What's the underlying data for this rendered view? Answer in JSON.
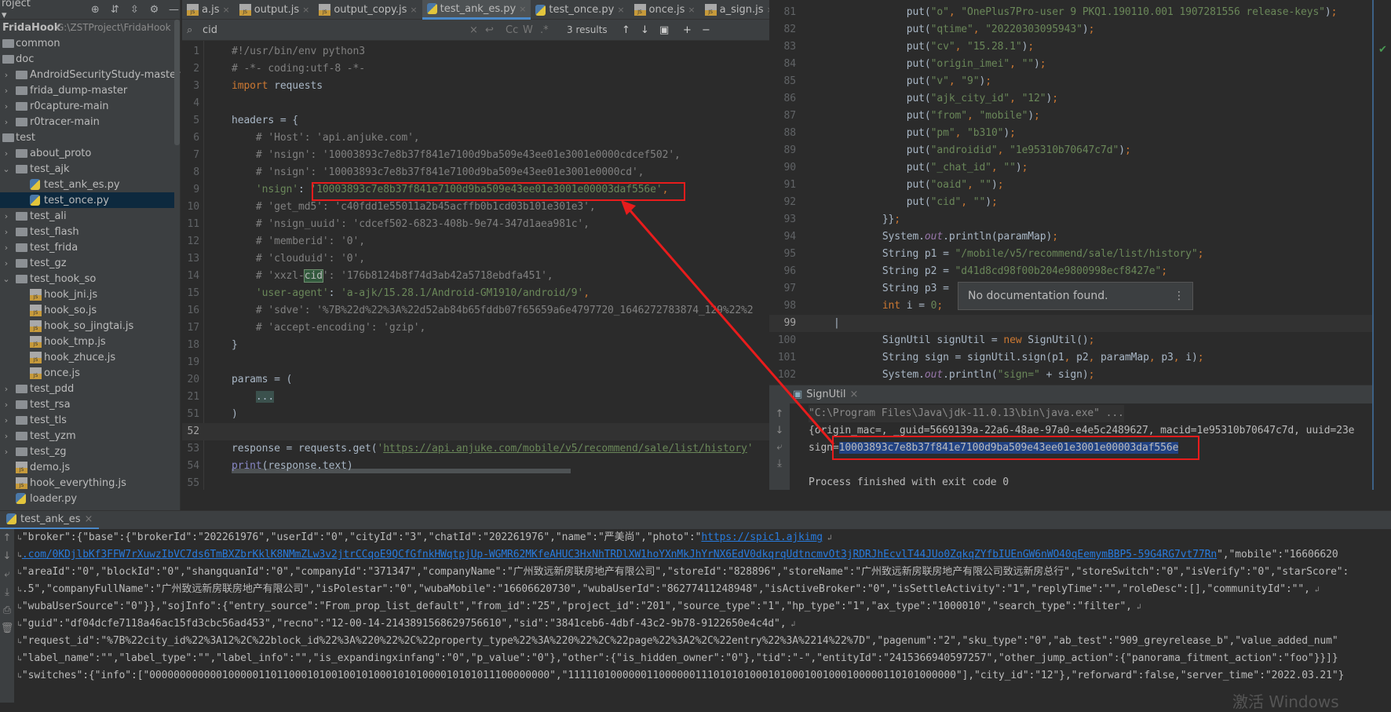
{
  "project_toolbar": {
    "title": "roject",
    "icons": [
      "target-icon",
      "expand-all-icon",
      "collapse-all-icon",
      "gear-icon",
      "minimize-icon"
    ]
  },
  "tree": [
    {
      "label": "FridaHook",
      "path": "G:\\ZSTProject\\FridaHook",
      "type": "root",
      "level": 0
    },
    {
      "label": "common",
      "type": "folder",
      "level": 0,
      "arrow": ""
    },
    {
      "label": "doc",
      "type": "folder",
      "level": 0,
      "arrow": ""
    },
    {
      "label": "AndroidSecurityStudy-master",
      "type": "folder",
      "level": 0,
      "arrow": "›"
    },
    {
      "label": "frida_dump-master",
      "type": "folder",
      "level": 0,
      "arrow": "›"
    },
    {
      "label": "r0capture-main",
      "type": "folder",
      "level": 0,
      "arrow": "›"
    },
    {
      "label": "r0tracer-main",
      "type": "folder",
      "level": 0,
      "arrow": "›"
    },
    {
      "label": "test",
      "type": "folder",
      "level": 0,
      "arrow": ""
    },
    {
      "label": "about_proto",
      "type": "folder",
      "level": 0,
      "arrow": "›"
    },
    {
      "label": "test_ajk",
      "type": "folder",
      "level": 0,
      "arrow": "⌄"
    },
    {
      "label": "test_ank_es.py",
      "type": "py",
      "level": 1
    },
    {
      "label": "test_once.py",
      "type": "py",
      "level": 1,
      "selected": true
    },
    {
      "label": "test_ali",
      "type": "folder",
      "level": 0,
      "arrow": "›"
    },
    {
      "label": "test_flash",
      "type": "folder",
      "level": 0,
      "arrow": "›"
    },
    {
      "label": "test_frida",
      "type": "folder",
      "level": 0,
      "arrow": "›"
    },
    {
      "label": "test_gz",
      "type": "folder",
      "level": 0,
      "arrow": "›"
    },
    {
      "label": "test_hook_so",
      "type": "folder",
      "level": 0,
      "arrow": "⌄"
    },
    {
      "label": "hook_jni.js",
      "type": "js",
      "level": 1
    },
    {
      "label": "hook_so.js",
      "type": "js",
      "level": 1
    },
    {
      "label": "hook_so_jingtai.js",
      "type": "js",
      "level": 1
    },
    {
      "label": "hook_tmp.js",
      "type": "js",
      "level": 1
    },
    {
      "label": "hook_zhuce.js",
      "type": "js",
      "level": 1
    },
    {
      "label": "once.js",
      "type": "js",
      "level": 1
    },
    {
      "label": "test_pdd",
      "type": "folder",
      "level": 0,
      "arrow": "›"
    },
    {
      "label": "test_rsa",
      "type": "folder",
      "level": 0,
      "arrow": "›"
    },
    {
      "label": "test_tls",
      "type": "folder",
      "level": 0,
      "arrow": "›"
    },
    {
      "label": "test_yzm",
      "type": "folder",
      "level": 0,
      "arrow": "›"
    },
    {
      "label": "test_zg",
      "type": "folder",
      "level": 0,
      "arrow": "›"
    },
    {
      "label": "demo.js",
      "type": "js",
      "level": 0
    },
    {
      "label": "hook_everything.js",
      "type": "js",
      "level": 0
    },
    {
      "label": "loader.py",
      "type": "py",
      "level": 0
    }
  ],
  "tabs": [
    {
      "label": "a.js",
      "type": "js"
    },
    {
      "label": "output.js",
      "type": "js"
    },
    {
      "label": "output_copy.js",
      "type": "js"
    },
    {
      "label": "test_ank_es.py",
      "type": "py",
      "active": true
    },
    {
      "label": "test_once.py",
      "type": "py"
    },
    {
      "label": "once.js",
      "type": "js"
    },
    {
      "label": "a_sign.js",
      "type": "js"
    }
  ],
  "search": {
    "value": "cid",
    "results": "3 results",
    "case_label": "Cc",
    "word_label": "W",
    "regex_label": ".*"
  },
  "editor_lines": [
    {
      "n": "1",
      "t": [
        [
          "c",
          "#!/usr/bin/env python3"
        ]
      ]
    },
    {
      "n": "2",
      "t": [
        [
          "c",
          "# -*- coding:utf-8 -*-"
        ]
      ]
    },
    {
      "n": "3",
      "t": [
        [
          "k",
          "import"
        ],
        [
          "p",
          " requests"
        ]
      ]
    },
    {
      "n": "4",
      "t": []
    },
    {
      "n": "5",
      "t": [
        [
          "p",
          "headers = {"
        ]
      ]
    },
    {
      "n": "6",
      "t": [
        [
          "c",
          "    # 'Host': 'api.anjuke.com',"
        ]
      ]
    },
    {
      "n": "7",
      "t": [
        [
          "c",
          "    # 'nsign': '10003893c7e8b37f841e7100d9ba509e43ee01e3001e0000cdcef502',"
        ]
      ]
    },
    {
      "n": "8",
      "t": [
        [
          "c",
          "    # 'nsign': '10003893c7e8b37f841e7100d9ba509e43ee01e3001e0000cd',"
        ]
      ]
    },
    {
      "n": "9",
      "t": [
        [
          "s",
          "    'nsign'"
        ],
        [
          "p",
          ": "
        ],
        [
          "s",
          "'10003893c7e8b37f841e7100d9ba509e43ee01e3001e00003daf556e'"
        ],
        [
          "k",
          ","
        ]
      ]
    },
    {
      "n": "10",
      "t": [
        [
          "c",
          "    # 'get_md5': 'c40fdd1e55011a2b45acffb0b1cd03b101e301e3',"
        ]
      ]
    },
    {
      "n": "11",
      "t": [
        [
          "c",
          "    # 'nsign_uuid': 'cdcef502-6823-408b-9e74-347d1aea981c',"
        ]
      ]
    },
    {
      "n": "12",
      "t": [
        [
          "c",
          "    # 'memberid': '0',"
        ]
      ]
    },
    {
      "n": "13",
      "t": [
        [
          "c",
          "    # 'clouduid': '0',"
        ]
      ]
    },
    {
      "n": "14",
      "t": [
        [
          "c",
          "    # 'xxzl-"
        ],
        [
          "h",
          "cid"
        ],
        [
          "c",
          "': '176b8124b8f74d3ab42a5718ebdfa451',"
        ]
      ]
    },
    {
      "n": "15",
      "t": [
        [
          "s",
          "    'user-agent'"
        ],
        [
          "p",
          ": "
        ],
        [
          "s",
          "'a-ajk/15.28.1/Android-GM1910/android/9'"
        ],
        [
          "k",
          ","
        ]
      ]
    },
    {
      "n": "16",
      "t": [
        [
          "c",
          "    # 'sdve': '%7B%22d%22%3A%22d52ab84b65fddb07f65659a6e4797720_1646272783874_129%22%2"
        ]
      ]
    },
    {
      "n": "17",
      "t": [
        [
          "c",
          "    # 'accept-encoding': 'gzip',"
        ]
      ]
    },
    {
      "n": "18",
      "t": [
        [
          "p",
          "}"
        ]
      ]
    },
    {
      "n": "19",
      "t": []
    },
    {
      "n": "20",
      "t": [
        [
          "p",
          "params = ("
        ]
      ]
    },
    {
      "n": "21",
      "t": [
        [
          "p",
          "    "
        ],
        [
          "g",
          "..."
        ]
      ]
    },
    {
      "n": "51",
      "t": [
        [
          "p",
          ")"
        ]
      ]
    },
    {
      "n": "52",
      "t": [],
      "current": true
    },
    {
      "n": "53",
      "t": [
        [
          "p",
          "response = requests.get("
        ],
        [
          "s",
          "'"
        ],
        [
          "u",
          "https://api.anjuke.com/mobile/v5/recommend/sale/list/history"
        ],
        [
          "s",
          "'"
        ]
      ]
    },
    {
      "n": "54",
      "t": [
        [
          "f",
          "print"
        ],
        [
          "p",
          "(response.text)"
        ]
      ]
    },
    {
      "n": "55",
      "t": []
    }
  ],
  "java_lines": [
    {
      "n": "81",
      "t": [
        [
          "p",
          "            put("
        ],
        [
          "s",
          "\"o\""
        ],
        [
          "k",
          ", "
        ],
        [
          "s",
          "\"OnePlus7Pro-user 9 PKQ1.190110.001 1907281556 release-keys\""
        ],
        [
          "p",
          ")"
        ],
        [
          "k",
          ";"
        ]
      ]
    },
    {
      "n": "82",
      "t": [
        [
          "p",
          "            put("
        ],
        [
          "s",
          "\"qtime\""
        ],
        [
          "k",
          ", "
        ],
        [
          "s",
          "\"20220303095943\""
        ],
        [
          "p",
          ")"
        ],
        [
          "k",
          ";"
        ]
      ]
    },
    {
      "n": "83",
      "t": [
        [
          "p",
          "            put("
        ],
        [
          "s",
          "\"cv\""
        ],
        [
          "k",
          ", "
        ],
        [
          "s",
          "\"15.28.1\""
        ],
        [
          "p",
          ")"
        ],
        [
          "k",
          ";"
        ]
      ]
    },
    {
      "n": "84",
      "t": [
        [
          "p",
          "            put("
        ],
        [
          "s",
          "\"origin_imei\""
        ],
        [
          "k",
          ", "
        ],
        [
          "s",
          "\"\""
        ],
        [
          "p",
          ")"
        ],
        [
          "k",
          ";"
        ]
      ]
    },
    {
      "n": "85",
      "t": [
        [
          "p",
          "            put("
        ],
        [
          "s",
          "\"v\""
        ],
        [
          "k",
          ", "
        ],
        [
          "s",
          "\"9\""
        ],
        [
          "p",
          ")"
        ],
        [
          "k",
          ";"
        ]
      ]
    },
    {
      "n": "86",
      "t": [
        [
          "p",
          "            put("
        ],
        [
          "s",
          "\"ajk_city_id\""
        ],
        [
          "k",
          ", "
        ],
        [
          "s",
          "\"12\""
        ],
        [
          "p",
          ")"
        ],
        [
          "k",
          ";"
        ]
      ]
    },
    {
      "n": "87",
      "t": [
        [
          "p",
          "            put("
        ],
        [
          "s",
          "\"from\""
        ],
        [
          "k",
          ", "
        ],
        [
          "s",
          "\"mobile\""
        ],
        [
          "p",
          ")"
        ],
        [
          "k",
          ";"
        ]
      ]
    },
    {
      "n": "88",
      "t": [
        [
          "p",
          "            put("
        ],
        [
          "s",
          "\"pm\""
        ],
        [
          "k",
          ", "
        ],
        [
          "s",
          "\"b310\""
        ],
        [
          "p",
          ")"
        ],
        [
          "k",
          ";"
        ]
      ]
    },
    {
      "n": "89",
      "t": [
        [
          "p",
          "            put("
        ],
        [
          "s",
          "\"androidid\""
        ],
        [
          "k",
          ", "
        ],
        [
          "s",
          "\"1e95310b70647c7d\""
        ],
        [
          "p",
          ")"
        ],
        [
          "k",
          ";"
        ]
      ]
    },
    {
      "n": "90",
      "t": [
        [
          "p",
          "            put("
        ],
        [
          "s",
          "\"_chat_id\""
        ],
        [
          "k",
          ", "
        ],
        [
          "s",
          "\"\""
        ],
        [
          "p",
          ")"
        ],
        [
          "k",
          ";"
        ]
      ]
    },
    {
      "n": "91",
      "t": [
        [
          "p",
          "            put("
        ],
        [
          "s",
          "\"oaid\""
        ],
        [
          "k",
          ", "
        ],
        [
          "s",
          "\"\""
        ],
        [
          "p",
          ")"
        ],
        [
          "k",
          ";"
        ]
      ]
    },
    {
      "n": "92",
      "t": [
        [
          "p",
          "            put("
        ],
        [
          "s",
          "\"cid\""
        ],
        [
          "k",
          ", "
        ],
        [
          "s",
          "\"\""
        ],
        [
          "p",
          ")"
        ],
        [
          "k",
          ";"
        ]
      ]
    },
    {
      "n": "93",
      "t": [
        [
          "p",
          "        }}"
        ],
        [
          "k",
          ";"
        ]
      ]
    },
    {
      "n": "94",
      "t": [
        [
          "p",
          "        System."
        ],
        [
          "o",
          "out"
        ],
        [
          "p",
          ".println(paramMap)"
        ],
        [
          "k",
          ";"
        ]
      ]
    },
    {
      "n": "95",
      "t": [
        [
          "p",
          "        String p1 = "
        ],
        [
          "s",
          "\"/mobile/v5/recommend/sale/list/history\""
        ],
        [
          "k",
          ";"
        ]
      ]
    },
    {
      "n": "96",
      "t": [
        [
          "p",
          "        String p2 = "
        ],
        [
          "s",
          "\"d41d8cd98f00b204e9800998ecf8427e\""
        ],
        [
          "k",
          ";"
        ]
      ]
    },
    {
      "n": "97",
      "t": [
        [
          "p",
          "        String p3 = "
        ]
      ]
    },
    {
      "n": "98",
      "t": [
        [
          "k",
          "        int "
        ],
        [
          "p",
          "i = "
        ],
        [
          "s",
          "0"
        ],
        [
          "k",
          ";"
        ]
      ]
    },
    {
      "n": "99",
      "t": [
        [
          "p",
          "|"
        ]
      ],
      "current": true
    },
    {
      "n": "100",
      "t": [
        [
          "p",
          "        SignUtil signUtil = "
        ],
        [
          "k",
          "new "
        ],
        [
          "p",
          "SignUtil()"
        ],
        [
          "k",
          ";"
        ]
      ]
    },
    {
      "n": "101",
      "t": [
        [
          "p",
          "        String sign = signUtil.sign(p1"
        ],
        [
          "k",
          ", "
        ],
        [
          "p",
          "p2"
        ],
        [
          "k",
          ", "
        ],
        [
          "p",
          "paramMap"
        ],
        [
          "k",
          ", "
        ],
        [
          "p",
          "p3"
        ],
        [
          "k",
          ", "
        ],
        [
          "p",
          "i)"
        ],
        [
          "k",
          ";"
        ]
      ]
    },
    {
      "n": "102",
      "t": [
        [
          "p",
          "        System."
        ],
        [
          "o",
          "out"
        ],
        [
          "p",
          ".println("
        ],
        [
          "s",
          "\"sign=\""
        ],
        [
          "p",
          " + sign)"
        ],
        [
          "k",
          ";"
        ]
      ]
    }
  ],
  "tooltip": {
    "text": "No documentation found."
  },
  "run_panel": {
    "tab": "SignUtil",
    "lines": [
      "\"C:\\Program Files\\Java\\jdk-11.0.13\\bin\\java.exe\" ...",
      "{origin_mac=, _guid=5669139a-22a6-48ae-97a0-e4e5c2489627, macid=1e95310b70647c7d, uuid=23e"
    ],
    "sign_prefix": "sign=",
    "sign_value": "10003893c7e8b37f841e7100d9ba509e43ee01e3001e00003daf556e",
    "exit": "Process finished with exit code 0"
  },
  "bottom_console": {
    "tab": "test_ank_es",
    "lines": [
      {
        "t": "\"broker\":{\"base\":{\"brokerId\":\"202261976\",\"userId\":\"0\",\"cityId\":\"3\",\"chatId\":\"202261976\",\"name\":\"严美尚\",\"photo\":\"",
        "link": "https://spic1.ajkimg",
        "wrap": true
      },
      {
        "t": "",
        "link": ".com/0KDjlbKf3FFW7rXuwzIbVC7ds6TmBXZbrKklK8NMmZLw3v2jtrCCqoE9QCfGfnkHWqtpjUp-WGMR62MKfeAHUC3HxNhTRDlXW1hoYXnMkJhYrNX6EdV0dkqrqUdtncmvOt3jRDRJhEcvlT44JUo0ZqkqZYfbIUEnGW6nWO40qEemymBBP5-59G4RG7vt77Rn",
        "after": "\",\"mobile\":\"16606620"
      },
      {
        "t": "\"areaId\":\"0\",\"blockId\":\"0\",\"shangquanId\":\"0\",\"companyId\":\"371347\",\"companyName\":\"广州致远新房联房地产有限公司\",\"storeId\":\"828896\",\"storeName\":\"广州致远新房联房地产有限公司致远新房总行\",\"storeSwitch\":\"0\",\"isVerify\":\"0\",\"starScore\":"
      },
      {
        "t": ".5\",\"companyFullName\":\"广州致远新房联房地产有限公司\",\"isPolestar\":\"0\",\"wubaMobile\":\"16606620730\",\"wubaUserId\":\"86277411248948\",\"isActiveBroker\":\"0\",\"isSettleActivity\":\"1\",\"replyTime\":\"\",\"roleDesc\":[],\"communityId\":\"\",",
        "wrap": true
      },
      {
        "t": "\"wubaUserSource\":\"0\"}},\"sojInfo\":{\"entry_source\":\"From_prop_list_default\",\"from_id\":\"25\",\"project_id\":\"201\",\"source_type\":\"1\",\"hp_type\":\"1\",\"ax_type\":\"1000010\",\"search_type\":\"filter\",",
        "wrap": true
      },
      {
        "t": "\"guid\":\"df04dcfe7118a46ac15fd3cbc56ad453\",\"recno\":\"12-00-14-2143891568629756610\",\"sid\":\"3841ceb6-4dbf-43c2-9b78-9122650e4c4d\",",
        "wrap": true
      },
      {
        "t": "\"request_id\":\"%7B%22city_id%22%3A12%2C%22block_id%22%3A%220%22%2C%22property_type%22%3A%220%22%2C%22page%22%3A2%2C%22entry%22%3A%2214%22%7D\",\"pagenum\":\"2\",\"sku_type\":\"0\",\"ab_test\":\"909_greyrelease_b\",\"value_added_num\""
      },
      {
        "t": "\"label_name\":\"\",\"label_type\":\"\",\"label_info\":\"\",\"is_expandingxinfang\":\"0\",\"p_value\":\"0\"},\"other\":{\"is_hidden_owner\":\"0\"},\"tid\":\"-\",\"entityId\":\"2415366940597257\",\"other_jump_action\":{\"panorama_fitment_action\":\"foo\"}}]}"
      },
      {
        "t": "\"switches\":{\"info\":[\"000000000000100000110110001010010010100010101000010101011100000000\",\"1111101000000110000001110101010001010001001000100000110101000000\"],\"city_id\":\"12\"},\"reforward\":false,\"server_time\":\"2022.03.21\"}"
      }
    ]
  },
  "watermark": "激活 Windows",
  "colors": {
    "annotation": "#e81c1c",
    "selection": "#214283",
    "accent": "#4a88c7"
  }
}
